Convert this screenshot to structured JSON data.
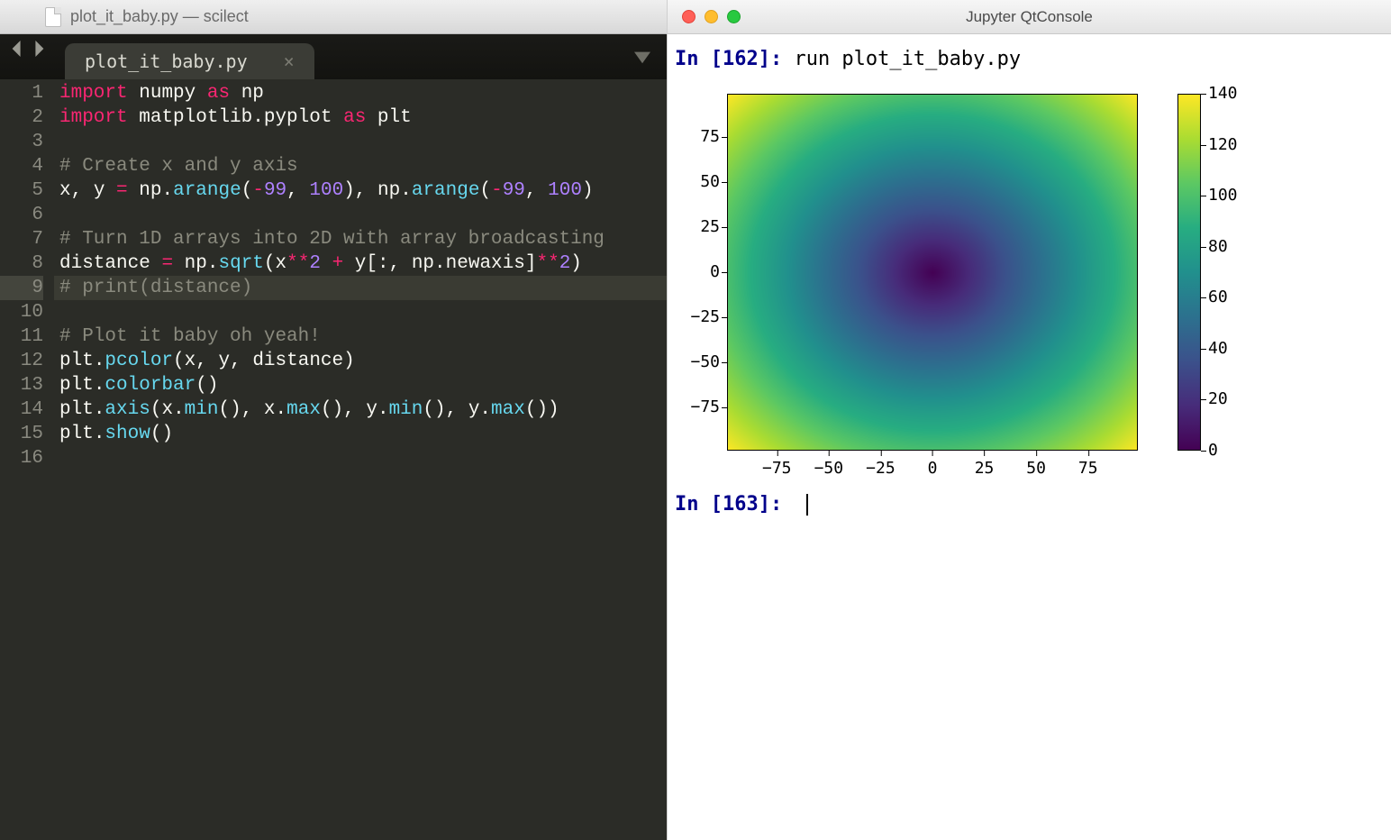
{
  "editor": {
    "titlebar": "plot_it_baby.py — scilect",
    "tab_label": "plot_it_baby.py",
    "tab_close": "×",
    "gutter": [
      "1",
      "2",
      "3",
      "4",
      "5",
      "6",
      "7",
      "8",
      "9",
      "10",
      "11",
      "12",
      "13",
      "14",
      "15",
      "16"
    ],
    "highlight_line_index": 8,
    "code_lines": [
      [
        [
          "kw-import",
          "import"
        ],
        [
          "sp",
          " "
        ],
        [
          "name",
          "numpy"
        ],
        [
          "sp",
          " "
        ],
        [
          "kw-as",
          "as"
        ],
        [
          "sp",
          " "
        ],
        [
          "name",
          "np"
        ]
      ],
      [
        [
          "kw-import",
          "import"
        ],
        [
          "sp",
          " "
        ],
        [
          "name",
          "matplotlib.pyplot"
        ],
        [
          "sp",
          " "
        ],
        [
          "kw-as",
          "as"
        ],
        [
          "sp",
          " "
        ],
        [
          "name",
          "plt"
        ]
      ],
      [],
      [
        [
          "cm",
          "# Create x and y axis"
        ]
      ],
      [
        [
          "name",
          "x"
        ],
        [
          "punct",
          ", "
        ],
        [
          "name",
          "y"
        ],
        [
          "sp",
          " "
        ],
        [
          "op",
          "="
        ],
        [
          "sp",
          " "
        ],
        [
          "name",
          "np"
        ],
        [
          "punct",
          "."
        ],
        [
          "fn",
          "arange"
        ],
        [
          "punct",
          "("
        ],
        [
          "op",
          "-"
        ],
        [
          "num",
          "99"
        ],
        [
          "punct",
          ", "
        ],
        [
          "num",
          "100"
        ],
        [
          "punct",
          ")"
        ],
        [
          "punct",
          ", "
        ],
        [
          "name",
          "np"
        ],
        [
          "punct",
          "."
        ],
        [
          "fn",
          "arange"
        ],
        [
          "punct",
          "("
        ],
        [
          "op",
          "-"
        ],
        [
          "num",
          "99"
        ],
        [
          "punct",
          ", "
        ],
        [
          "num",
          "100"
        ],
        [
          "punct",
          ")"
        ]
      ],
      [],
      [
        [
          "cm",
          "# Turn 1D arrays into 2D with array broadcasting"
        ]
      ],
      [
        [
          "name",
          "distance"
        ],
        [
          "sp",
          " "
        ],
        [
          "op",
          "="
        ],
        [
          "sp",
          " "
        ],
        [
          "name",
          "np"
        ],
        [
          "punct",
          "."
        ],
        [
          "fn",
          "sqrt"
        ],
        [
          "punct",
          "("
        ],
        [
          "name",
          "x"
        ],
        [
          "op",
          "**"
        ],
        [
          "num",
          "2"
        ],
        [
          "sp",
          " "
        ],
        [
          "op",
          "+"
        ],
        [
          "sp",
          " "
        ],
        [
          "name",
          "y"
        ],
        [
          "punct",
          "[:, "
        ],
        [
          "name",
          "np"
        ],
        [
          "punct",
          "."
        ],
        [
          "name",
          "newaxis"
        ],
        [
          "punct",
          "]"
        ],
        [
          "op",
          "**"
        ],
        [
          "num",
          "2"
        ],
        [
          "punct",
          ")"
        ]
      ],
      [
        [
          "cm",
          "# print(distance)"
        ]
      ],
      [],
      [
        [
          "cm",
          "# Plot it baby oh yeah!"
        ]
      ],
      [
        [
          "name",
          "plt"
        ],
        [
          "punct",
          "."
        ],
        [
          "fn",
          "pcolor"
        ],
        [
          "punct",
          "("
        ],
        [
          "name",
          "x"
        ],
        [
          "punct",
          ", "
        ],
        [
          "name",
          "y"
        ],
        [
          "punct",
          ", "
        ],
        [
          "name",
          "distance"
        ],
        [
          "punct",
          ")"
        ]
      ],
      [
        [
          "name",
          "plt"
        ],
        [
          "punct",
          "."
        ],
        [
          "fn",
          "colorbar"
        ],
        [
          "punct",
          "()"
        ]
      ],
      [
        [
          "name",
          "plt"
        ],
        [
          "punct",
          "."
        ],
        [
          "fn",
          "axis"
        ],
        [
          "punct",
          "("
        ],
        [
          "name",
          "x"
        ],
        [
          "punct",
          "."
        ],
        [
          "fn",
          "min"
        ],
        [
          "punct",
          "(), "
        ],
        [
          "name",
          "x"
        ],
        [
          "punct",
          "."
        ],
        [
          "fn",
          "max"
        ],
        [
          "punct",
          "(), "
        ],
        [
          "name",
          "y"
        ],
        [
          "punct",
          "."
        ],
        [
          "fn",
          "min"
        ],
        [
          "punct",
          "(), "
        ],
        [
          "name",
          "y"
        ],
        [
          "punct",
          "."
        ],
        [
          "fn",
          "max"
        ],
        [
          "punct",
          "())"
        ]
      ],
      [
        [
          "name",
          "plt"
        ],
        [
          "punct",
          "."
        ],
        [
          "fn",
          "show"
        ],
        [
          "punct",
          "()"
        ]
      ],
      []
    ]
  },
  "console": {
    "window_title": "Jupyter QtConsole",
    "prompt1": "In [162]: ",
    "cmd1": "run plot_it_baby.py",
    "prompt2": "In [163]: "
  },
  "chart_data": {
    "type": "heatmap",
    "title": "",
    "xlabel": "",
    "ylabel": "",
    "x_ticks": [
      -75,
      -50,
      -25,
      0,
      25,
      50,
      75
    ],
    "y_ticks": [
      -75,
      -50,
      -25,
      0,
      25,
      50,
      75
    ],
    "xlim": [
      -99,
      99
    ],
    "ylim": [
      -99,
      99
    ],
    "colorbar_ticks": [
      0,
      20,
      40,
      60,
      80,
      100,
      120,
      140
    ],
    "colorbar_range": [
      0,
      140
    ],
    "colormap": "viridis",
    "formula": "sqrt(x**2 + y**2)",
    "description": "Euclidean distance from origin over 199×199 grid (x,y in -99..99). Value at center (0,0)=0, at extreme corners ≈140."
  }
}
